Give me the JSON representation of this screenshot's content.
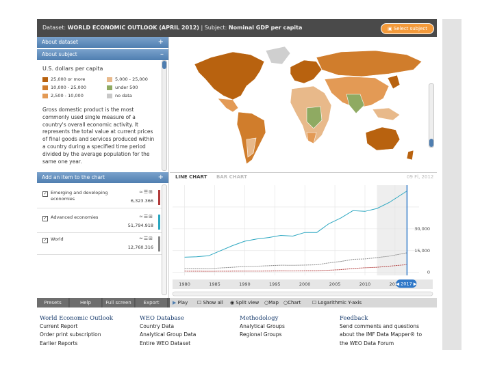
{
  "header": {
    "dataset_label": "Dataset:",
    "dataset_value": "WORLD ECONOMIC OUTLOOK (APRIL 2012)",
    "separator": "|",
    "subject_label": "Subject:",
    "subject_value": "Nominal GDP per capita",
    "select_button": "Select subject"
  },
  "left_panel": {
    "about_dataset": "About dataset",
    "about_subject": "About subject",
    "plus": "+",
    "minus": "–",
    "legend_title": "U.S. dollars per capita",
    "legend": [
      {
        "label": "25,000 or more",
        "color": "#b8620f"
      },
      {
        "label": "5,000 - 25,000",
        "color": "#e8b98a"
      },
      {
        "label": "10,000 - 25,000",
        "color": "#d07d2c"
      },
      {
        "label": "under 500",
        "color": "#8faa62"
      },
      {
        "label": "2,500 - 10,000",
        "color": "#e39a55"
      },
      {
        "label": "no data",
        "color": "#c8c8c8"
      }
    ],
    "description": "Gross domestic product is the most commonly used single measure of a country's overall economic activity. It represents the total value at current prices of final goods and services produced within a country during a specified time period divided by the average population for the same one year.",
    "add_item": "Add an item to the chart",
    "items": [
      {
        "name": "Emerging and developing economies",
        "value": "6,323.366",
        "color": "#b03a3a"
      },
      {
        "name": "Advanced economies",
        "value": "51,794.918",
        "color": "#2aa6c0"
      },
      {
        "name": "World",
        "value": "12,760.316",
        "color": "#888888"
      }
    ]
  },
  "chart": {
    "tab_line": "LINE CHART",
    "tab_bar": "BAR CHART",
    "date_label": "09 Fl, 2012",
    "year_badge": "2017",
    "ylabels": [
      "30,000",
      "15,000",
      "0"
    ],
    "xlabels": [
      "1980",
      "1985",
      "1990",
      "1995",
      "2000",
      "2005",
      "2010",
      "2015"
    ]
  },
  "chart_data": {
    "type": "line",
    "x": [
      1980,
      1982,
      1984,
      1986,
      1988,
      1990,
      1992,
      1994,
      1996,
      1998,
      2000,
      2002,
      2004,
      2006,
      2008,
      2010,
      2012,
      2014,
      2017
    ],
    "series": [
      {
        "name": "Emerging and developing economies",
        "color": "#b03a3a",
        "values": [
          900,
          850,
          800,
          850,
          900,
          950,
          900,
          1000,
          1100,
          1050,
          1150,
          1200,
          1500,
          2000,
          2700,
          3200,
          3600,
          4300,
          5400
        ]
      },
      {
        "name": "Advanced economies",
        "color": "#2aa6c0",
        "values": [
          10500,
          10800,
          11500,
          15000,
          18500,
          21500,
          23000,
          24000,
          25500,
          25000,
          27500,
          27500,
          33500,
          37500,
          42500,
          42000,
          44000,
          48000,
          56000
        ]
      },
      {
        "name": "World",
        "color": "#888888",
        "values": [
          2700,
          2650,
          2600,
          3100,
          3600,
          4100,
          4300,
          4600,
          5000,
          4900,
          5100,
          5300,
          6600,
          7600,
          9000,
          9300,
          10200,
          11200,
          13500
        ]
      }
    ],
    "xlim": [
      1978,
      2019
    ],
    "ylim": [
      -2000,
      60000
    ]
  },
  "controls": {
    "play": "Play",
    "show_all": "Show all",
    "split_view": "Split view",
    "map": "Map",
    "chart": "Chart",
    "log_label": "Logarithmic Y-axis"
  },
  "bottom_buttons": [
    "Presets",
    "Help",
    "Full screen",
    "Export"
  ],
  "footer": {
    "cols": [
      {
        "head": "World Economic Outlook",
        "links": [
          "Current Report",
          "Order print subscription",
          "Earlier Reports"
        ]
      },
      {
        "head": "WEO Database",
        "links": [
          "Country Data",
          "Analytical Group Data",
          "Entire WEO Dataset"
        ]
      },
      {
        "head": "Methodology",
        "links": [
          "Analytical Groups",
          "Regional Groups"
        ]
      },
      {
        "head": "Feedback",
        "links": [
          "Send comments and questions",
          "about the IMF Data Mapper® to",
          "the WEO Data Forum"
        ]
      }
    ]
  }
}
